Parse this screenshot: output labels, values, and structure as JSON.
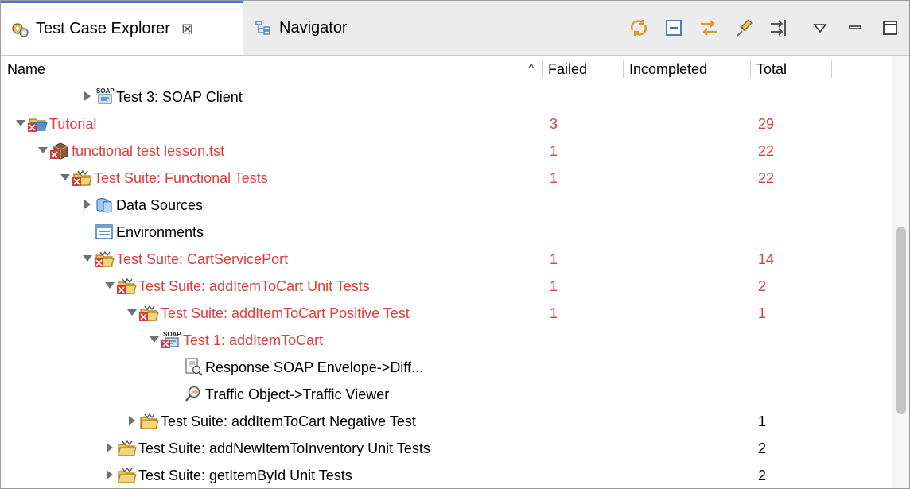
{
  "tabs": [
    {
      "label": "Test Case Explorer",
      "icon": "test-case-explorer-icon",
      "active": true,
      "close": "⊠"
    },
    {
      "label": "Navigator",
      "icon": "navigator-icon",
      "active": false
    }
  ],
  "toolbar": [
    {
      "name": "sync-icon"
    },
    {
      "name": "collapse-all-icon"
    },
    {
      "name": "link-with-editor-icon"
    },
    {
      "name": "pin-icon"
    },
    {
      "name": "filter-icon"
    },
    {
      "name": "view-menu-icon"
    },
    {
      "name": "minimize-icon"
    },
    {
      "name": "maximize-icon"
    }
  ],
  "columns": {
    "name": "Name",
    "sort_indicator": "^",
    "failed": "Failed",
    "incompleted": "Incompleted",
    "total": "Total"
  },
  "colors": {
    "failure_red": "#e03c3c",
    "accent_blue": "#3d7bd8"
  },
  "rows": [
    {
      "label": "Test 3: SOAP Client",
      "depth": 4,
      "toggle": "collapsed",
      "icon": "soap-client-test-icon",
      "failed": "",
      "total": "",
      "red": false
    },
    {
      "label": "Tutorial",
      "depth": 1,
      "toggle": "expanded",
      "icon": "project-folder-failed-icon",
      "failed": "3",
      "total": "29",
      "red": true
    },
    {
      "label": "functional test lesson.tst",
      "depth": 2,
      "toggle": "expanded",
      "icon": "test-file-failed-icon",
      "failed": "1",
      "total": "22",
      "red": true
    },
    {
      "label": "Test Suite: Functional Tests",
      "depth": 3,
      "toggle": "expanded",
      "icon": "test-suite-failed-icon",
      "failed": "1",
      "total": "22",
      "red": true
    },
    {
      "label": "Data Sources",
      "depth": 4,
      "toggle": "collapsed",
      "icon": "data-sources-icon",
      "failed": "",
      "total": "",
      "red": false
    },
    {
      "label": "Environments",
      "depth": 4,
      "toggle": "none",
      "icon": "environments-icon",
      "failed": "",
      "total": "",
      "red": false
    },
    {
      "label": "Test Suite: CartServicePort",
      "depth": 4,
      "toggle": "expanded",
      "icon": "test-suite-failed-icon",
      "failed": "1",
      "total": "14",
      "red": true
    },
    {
      "label": "Test Suite: addItemToCart Unit Tests",
      "depth": 5,
      "toggle": "expanded",
      "icon": "test-suite-failed-icon",
      "failed": "1",
      "total": "2",
      "red": true
    },
    {
      "label": "Test Suite: addItemToCart Positive Test",
      "depth": 6,
      "toggle": "expanded",
      "icon": "test-suite-failed-icon",
      "failed": "1",
      "total": "1",
      "red": true
    },
    {
      "label": "Test 1: addItemToCart",
      "depth": 7,
      "toggle": "expanded",
      "icon": "soap-client-test-failed-icon",
      "failed": "",
      "total": "",
      "red": true
    },
    {
      "label": "Response SOAP Envelope->Diff...",
      "depth": 8,
      "toggle": "none",
      "icon": "diff-tool-icon",
      "failed": "",
      "total": "",
      "red": false
    },
    {
      "label": "Traffic Object->Traffic Viewer",
      "depth": 8,
      "toggle": "none",
      "icon": "traffic-viewer-icon",
      "failed": "",
      "total": "",
      "red": false
    },
    {
      "label": "Test Suite: addItemToCart Negative Test",
      "depth": 6,
      "toggle": "collapsed",
      "icon": "test-suite-icon",
      "failed": "",
      "total": "1",
      "red": false
    },
    {
      "label": "Test Suite: addNewItemToInventory Unit Tests",
      "depth": 5,
      "toggle": "collapsed",
      "icon": "test-suite-icon",
      "failed": "",
      "total": "2",
      "red": false
    },
    {
      "label": "Test Suite: getItemById Unit Tests",
      "depth": 5,
      "toggle": "collapsed",
      "icon": "test-suite-icon",
      "failed": "",
      "total": "2",
      "red": false
    }
  ]
}
